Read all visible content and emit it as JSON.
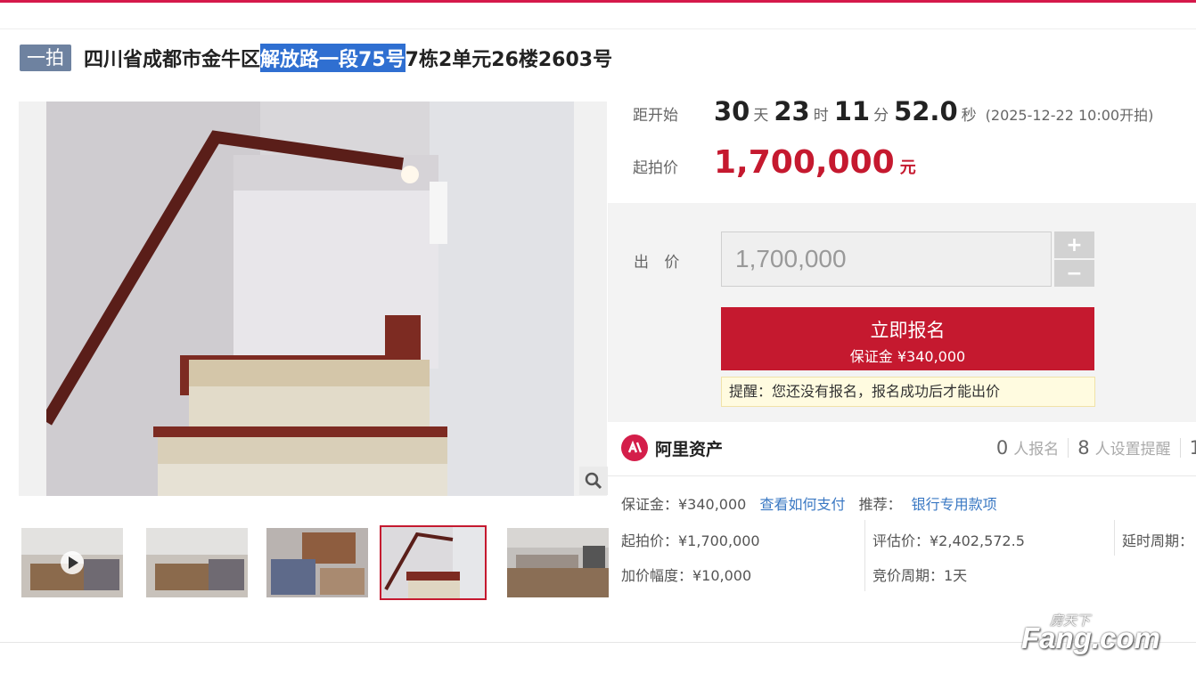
{
  "listing": {
    "tag": "一拍",
    "title_pre": "四川省成都市金牛区",
    "title_hl": "解放路一段75号",
    "title_post": "7栋2单元26楼2603号"
  },
  "countdown": {
    "label": "距开始",
    "days": "30",
    "days_unit": "天",
    "hours": "23",
    "hours_unit": "时",
    "minutes": "11",
    "minutes_unit": "分",
    "seconds": "52.0",
    "seconds_unit": "秒",
    "start_note": "(2025-12-22 10:00开拍)"
  },
  "start_price": {
    "label": "起拍价",
    "value": "1,700,000",
    "unit": "元"
  },
  "bid": {
    "label": "出 价",
    "input_value": "1,700,000",
    "plus": "+",
    "minus": "−",
    "signup_label": "立即报名",
    "signup_deposit": "保证金 ¥340,000",
    "reminder": "提醒：您还没有报名，报名成功后才能出价"
  },
  "platform": {
    "name": "阿里资产",
    "signup_count": "0",
    "signup_text": "人报名",
    "remind_count": "8",
    "remind_text": "人设置提醒",
    "extra_count": "1"
  },
  "details": {
    "deposit": "保证金：¥340,000",
    "pay_link": "查看如何支付",
    "recommend_label": "推荐：",
    "recommend_link": "银行专用款项",
    "start_price": "起拍价：¥1,700,000",
    "appraisal": "评估价：¥2,402,572.5",
    "delay": "延时周期：",
    "increment": "加价幅度：¥10,000",
    "cycle": "竞价周期：1天"
  },
  "watermark": {
    "small": "房天下",
    "big": "Fang.com"
  },
  "colors": {
    "brand_red": "#c5192f",
    "tag_blue": "#6e82a0",
    "highlight": "#2f6fd1",
    "link": "#3a78c3"
  }
}
